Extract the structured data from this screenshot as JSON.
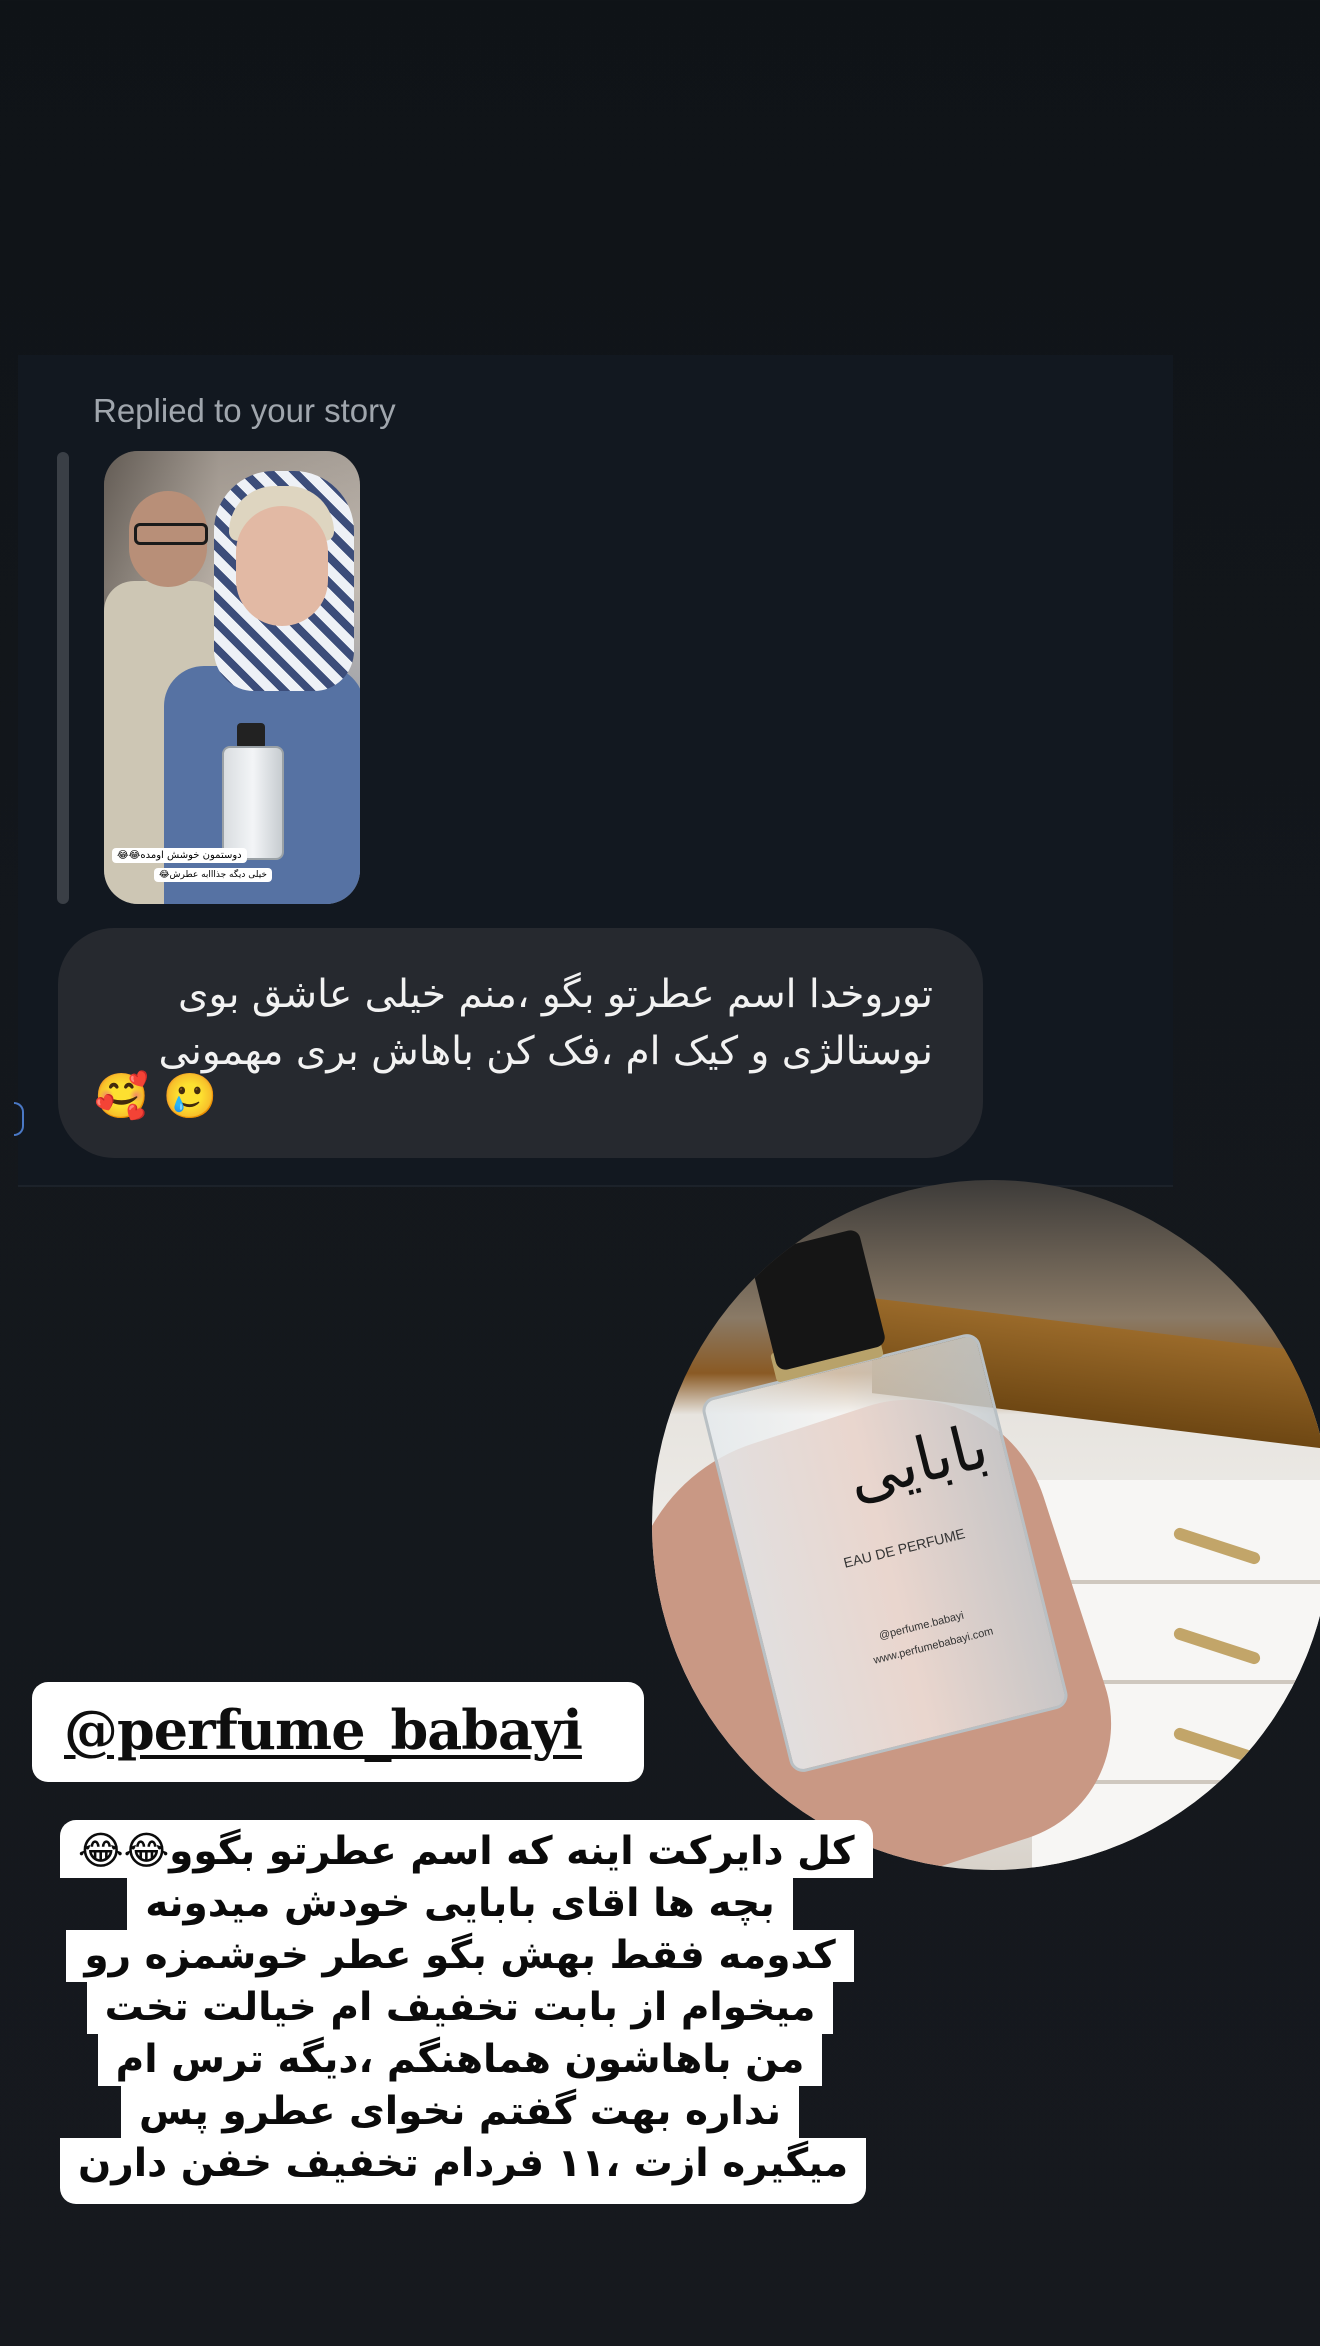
{
  "dm": {
    "replied_label": "Replied to your story",
    "story_thumbnail": {
      "caption_line1": "دوستمون خوشش اومده😂😂",
      "caption_line2": "خیلی دیگه جذااابه عطرش😂"
    },
    "message": {
      "text": "توروخدا اسم عطرتو بگو ،منم خیلی عاشق بوی\nنوستالژی و کیک ام ،فک کن باهاش بری مهمونی",
      "emojis": "🥰 🥲"
    }
  },
  "product_photo": {
    "logo_text": "بابایی",
    "label": "EAU DE PERFUME",
    "handle": "@perfume.babayi",
    "website": "www.perfumebabayi.com"
  },
  "mention": {
    "handle": "@perfume_babayi"
  },
  "caption": {
    "lines": [
      "کل دایرکت اینه که اسم عطرتو بگوو😂😂",
      "بچه ها اقای بابایی خودش میدونه",
      "کدومه فقط بهش بگو عطر خوشمزه رو",
      "میخوام از بابت تخفیف ام خیالت تخت",
      "من باهاشون هماهنگم ،دیگه ترس ام",
      "نداره بهت گفتم نخوای عطرو پس",
      "میگیره ازت ،۱۱ فردام تخفیف خفن دارن"
    ]
  },
  "colors": {
    "background": "#13171c",
    "bubble": "#26292f",
    "muted_text": "#a0a6ad",
    "sticker_bg": "#ffffff"
  }
}
